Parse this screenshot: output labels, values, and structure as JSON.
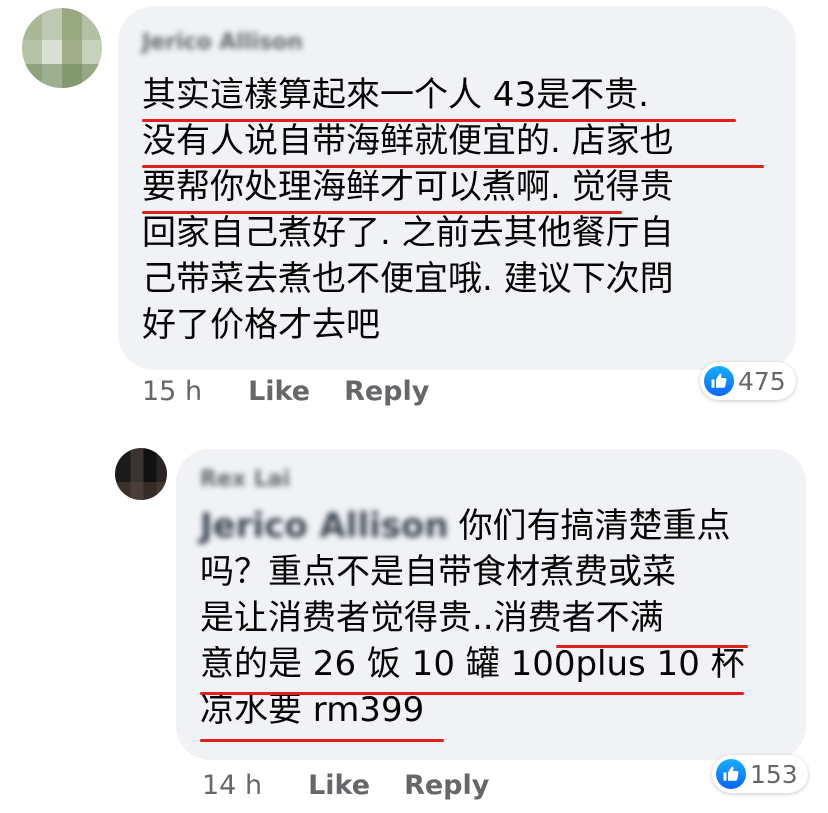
{
  "comments": [
    {
      "author": "Jerico Allison",
      "text_lines": [
        "其实這樣算起來一个人 43是不贵.",
        "没有人说自带海鲜就便宜的. 店家也",
        "要帮你处理海鲜才可以煮啊. 觉得贵",
        "回家自己煮好了. 之前去其他餐厅自",
        "己带菜去煮也不便宜哦. 建议下次問",
        "好了价格才去吧"
      ],
      "time": "15 h",
      "like_label": "Like",
      "reply_label": "Reply",
      "reaction_count": "475"
    },
    {
      "author": "Rex Lai",
      "tag": "Jerico Allison",
      "text_lines": [
        "你们有搞清楚重点",
        "吗？重点不是自带食材煮费或菜",
        "是让消费者觉得贵..消费者不满",
        "意的是 26 饭 10 罐 100plus 10 杯",
        "凉水要 rm399"
      ],
      "time": "14 h",
      "like_label": "Like",
      "reply_label": "Reply",
      "reaction_count": "153"
    }
  ],
  "colors": {
    "bubble": "#f0f2f5",
    "underline": "#e0201b",
    "meta": "#65676b",
    "like_blue": "#0866ff"
  },
  "icons": {
    "reaction": "like-thumb-icon"
  }
}
